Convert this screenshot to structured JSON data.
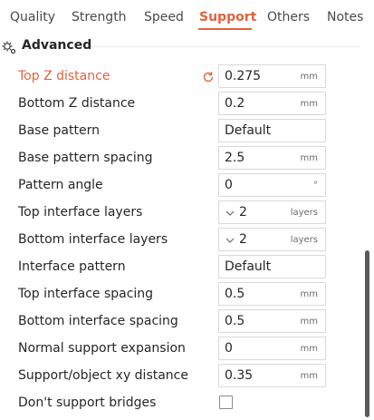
{
  "tabs": [
    "Quality",
    "Strength",
    "Speed",
    "Support",
    "Others",
    "Notes"
  ],
  "active_tab": "Support",
  "accent_color": "#e0633c",
  "section": {
    "title": "Advanced",
    "icon": "gear-icon"
  },
  "rows": [
    {
      "label": "Top Z distance",
      "value": "0.275",
      "unit": "mm",
      "modified": true
    },
    {
      "label": "Bottom Z distance",
      "value": "0.2",
      "unit": "mm"
    },
    {
      "label": "Base pattern",
      "value": "Default"
    },
    {
      "label": "Base pattern spacing",
      "value": "2.5",
      "unit": "mm"
    },
    {
      "label": "Pattern angle",
      "value": "0",
      "unit": "°"
    },
    {
      "label": "Top interface layers",
      "value": "2",
      "unit": "layers",
      "dropdown": true
    },
    {
      "label": "Bottom interface layers",
      "value": "2",
      "unit": "layers",
      "dropdown": true
    },
    {
      "label": "Interface pattern",
      "value": "Default"
    },
    {
      "label": "Top interface spacing",
      "value": "0.5",
      "unit": "mm"
    },
    {
      "label": "Bottom interface spacing",
      "value": "0.5",
      "unit": "mm"
    },
    {
      "label": "Normal support expansion",
      "value": "0",
      "unit": "mm"
    },
    {
      "label": "Support/object xy distance",
      "value": "0.35",
      "unit": "mm"
    },
    {
      "label": "Don't support bridges",
      "checkbox": true,
      "checked": false
    }
  ]
}
